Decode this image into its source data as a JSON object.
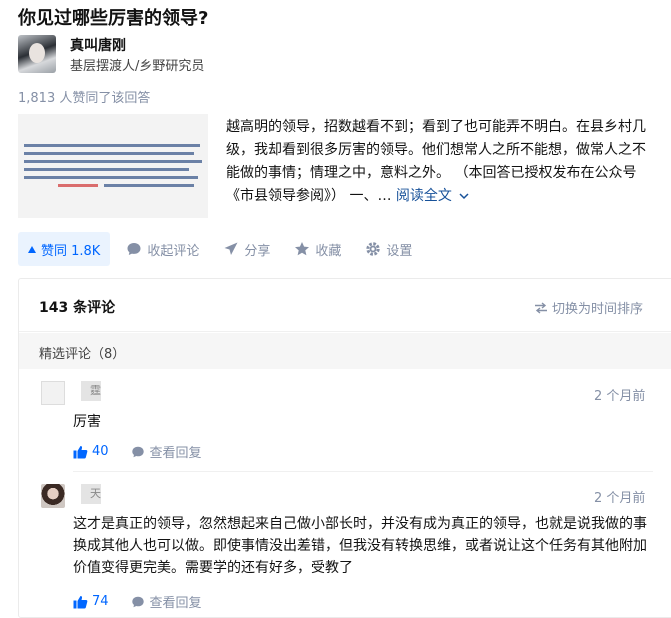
{
  "question": {
    "title": "你见过哪些厉害的领导?"
  },
  "author": {
    "name": "真叫唐刚",
    "bio": "基层摆渡人/乡野研究员"
  },
  "vote_summary": "1,813 人赞同了该回答",
  "answer": {
    "excerpt": "越高明的领导，招数越看不到；看到了也可能弄不明白。在县乡村几级，我却看到很多厉害的领导。他们想常人之所不能想，做常人之不能做的事情；情理之中，意料之外。 （本回答已授权发布在公众号《市县领导参阅》） 一、… ",
    "read_more": "阅读全文"
  },
  "actions": {
    "upvote": "赞同 1.8K",
    "collapse_comments": "收起评论",
    "share": "分享",
    "favorite": "收藏",
    "settings": "设置"
  },
  "comments": {
    "count_label": "143 条评论",
    "switch_label": "切换为时间排序",
    "featured_label": "精选评论（8）",
    "items": [
      {
        "name_char": "霆",
        "time": "2 个月前",
        "text": "厉害",
        "likes": "40",
        "view_replies": "查看回复"
      },
      {
        "name_char": "天",
        "time": "2 个月前",
        "text": "这才是真正的领导，忽然想起来自己做小部长时，并没有成为真正的领导，也就是说我做的事换成其他人也可以做。即使事情没出差错，但我没有转换思维，或者说让这个任务有其他附加价值变得更完美。需要学的还有好多，受教了",
        "likes": "74",
        "view_replies": "查看回复"
      }
    ]
  },
  "colors": {
    "accent": "#0066ff",
    "link": "#175199",
    "muted": "#8590a6"
  },
  "icons": [
    "upvote-icon",
    "comment-icon",
    "share-icon",
    "star-icon",
    "gear-icon",
    "switch-icon",
    "chevron-down-icon",
    "thumbs-up-icon"
  ]
}
